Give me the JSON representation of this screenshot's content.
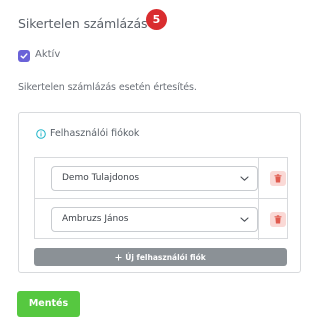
{
  "section": {
    "title": "Sikertelen számlázás",
    "step_badge": "5"
  },
  "active_checkbox": {
    "label": "Aktív",
    "checked": true
  },
  "description": "Sikertelen számlázás esetén értesítés.",
  "user_accounts": {
    "header": "Felhasználói fiókok",
    "rows": [
      {
        "selected": "Demo Tulajdonos"
      },
      {
        "selected": "Ambruzs János"
      }
    ],
    "add_button": "Új felhasználói fiók"
  },
  "save_button": "Mentés",
  "colors": {
    "accent": "#6a62d8",
    "badge": "#d92d2f",
    "save": "#56c840",
    "add_button": "#8b9196",
    "delete_bg": "#fad9d6",
    "delete_icon": "#e05b4f",
    "info_icon": "#1fb5c9"
  },
  "icons": {
    "checkbox": "check-icon",
    "header": "info-icon",
    "select": "chevron-down-icon",
    "delete": "trash-icon",
    "add": "plus-icon"
  }
}
